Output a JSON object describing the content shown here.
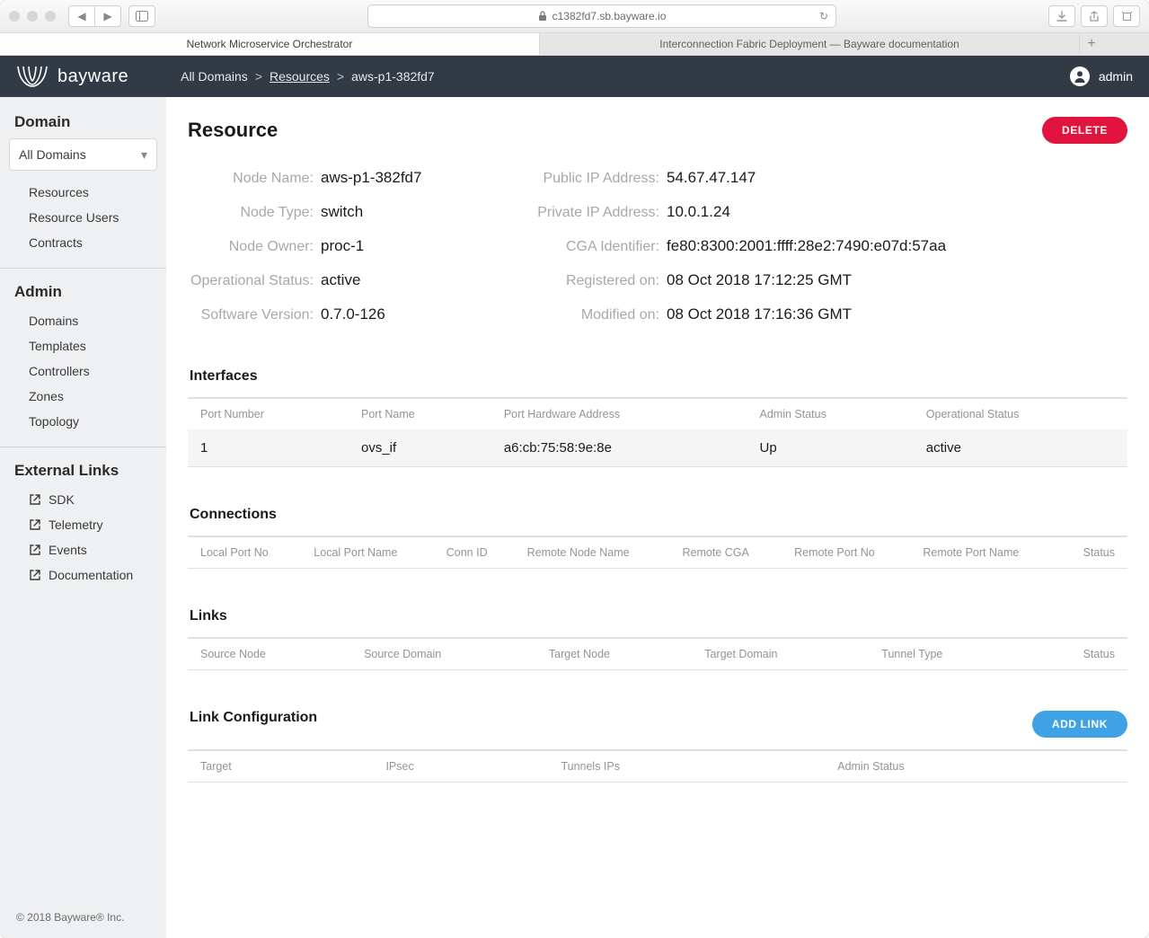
{
  "browser": {
    "url_host": "c1382fd7.sb.bayware.io",
    "tabs": [
      {
        "label": "Network Microservice Orchestrator",
        "active": true
      },
      {
        "label": "Interconnection Fabric Deployment — Bayware documentation",
        "active": false
      }
    ]
  },
  "header": {
    "brand": "bayware",
    "breadcrumbs": [
      {
        "label": "All Domains",
        "link": false
      },
      {
        "label": "Resources",
        "link": true
      },
      {
        "label": "aws-p1-382fd7",
        "link": false
      }
    ],
    "username": "admin"
  },
  "sidebar": {
    "domain_title": "Domain",
    "domain_selector_value": "All Domains",
    "domain_items": [
      "Resources",
      "Resource Users",
      "Contracts"
    ],
    "admin_title": "Admin",
    "admin_items": [
      "Domains",
      "Templates",
      "Controllers",
      "Zones",
      "Topology"
    ],
    "ext_title": "External Links",
    "ext_items": [
      "SDK",
      "Telemetry",
      "Events",
      "Documentation"
    ],
    "footer": "© 2018 Bayware® Inc."
  },
  "page": {
    "title": "Resource",
    "delete_label": "DELETE",
    "details_left": [
      {
        "label": "Node Name:",
        "value": "aws-p1-382fd7"
      },
      {
        "label": "Node Type:",
        "value": "switch"
      },
      {
        "label": "Node Owner:",
        "value": "proc-1"
      },
      {
        "label": "Operational Status:",
        "value": "active"
      },
      {
        "label": "Software Version:",
        "value": "0.7.0-126"
      }
    ],
    "details_right": [
      {
        "label": "Public IP Address:",
        "value": "54.67.47.147"
      },
      {
        "label": "Private IP Address:",
        "value": "10.0.1.24"
      },
      {
        "label": "CGA Identifier:",
        "value": "fe80:8300:2001:ffff:28e2:7490:e07d:57aa"
      },
      {
        "label": "Registered on:",
        "value": "08 Oct 2018 17:12:25 GMT"
      },
      {
        "label": "Modified on:",
        "value": "08 Oct 2018 17:16:36 GMT"
      }
    ],
    "interfaces": {
      "title": "Interfaces",
      "headers": [
        "Port Number",
        "Port Name",
        "Port Hardware Address",
        "Admin Status",
        "Operational Status"
      ],
      "rows": [
        {
          "port_number": "1",
          "port_name": "ovs_if",
          "hw_addr": "a6:cb:75:58:9e:8e",
          "admin_status": "Up",
          "op_status": "active"
        }
      ]
    },
    "connections": {
      "title": "Connections",
      "headers": [
        "Local Port No",
        "Local Port Name",
        "Conn ID",
        "Remote Node Name",
        "Remote CGA",
        "Remote Port No",
        "Remote Port Name",
        "Status"
      ]
    },
    "links": {
      "title": "Links",
      "headers": [
        "Source Node",
        "Source Domain",
        "Target Node",
        "Target Domain",
        "Tunnel Type",
        "Status"
      ]
    },
    "link_config": {
      "title": "Link Configuration",
      "add_label": "ADD LINK",
      "headers": [
        "Target",
        "IPsec",
        "Tunnels IPs",
        "Admin Status"
      ]
    }
  }
}
